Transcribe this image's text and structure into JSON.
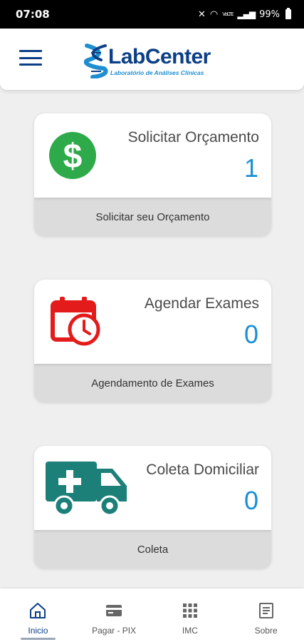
{
  "status_bar": {
    "time": "07:08",
    "network": "VoLTE",
    "battery": "99%"
  },
  "header": {
    "brand": "LabCenter",
    "tagline": "Laboratório de Análises Clínicas",
    "menu_icon": "hamburger-menu-icon"
  },
  "cards": [
    {
      "icon": "dollar-circle-icon",
      "title": "Solicitar Orçamento",
      "count": "1",
      "footer": "Solicitar seu Orçamento",
      "icon_color": "#2eaa4a"
    },
    {
      "icon": "calendar-clock-icon",
      "title": "Agendar Exames",
      "count": "0",
      "footer": "Agendamento de Exames",
      "icon_color": "#e31b1b"
    },
    {
      "icon": "ambulance-icon",
      "title": "Coleta Domiciliar",
      "count": "0",
      "footer": "Coleta",
      "icon_color": "#1c8078"
    }
  ],
  "bottom_nav": [
    {
      "label": "Inicio",
      "icon": "home-icon",
      "active": true
    },
    {
      "label": "Pagar - PIX",
      "icon": "card-icon",
      "active": false
    },
    {
      "label": "IMC",
      "icon": "grid-icon",
      "active": false
    },
    {
      "label": "Sobre",
      "icon": "document-icon",
      "active": false
    }
  ],
  "colors": {
    "brand": "#0b3f86",
    "accent": "#1a8fd6",
    "background": "#efefef"
  }
}
